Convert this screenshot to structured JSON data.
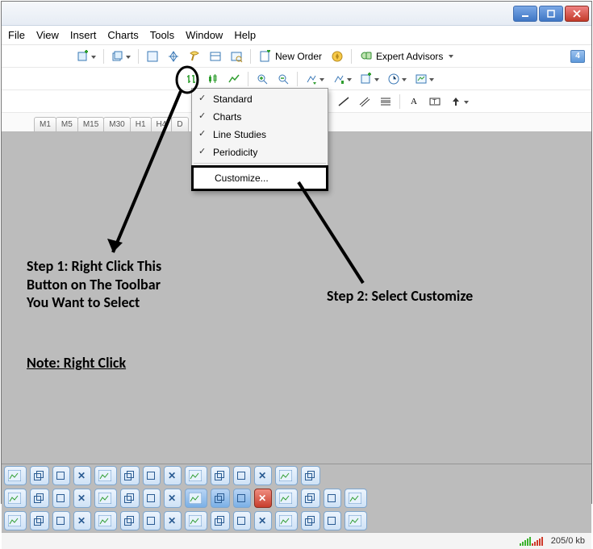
{
  "menu": {
    "file": "File",
    "view": "View",
    "insert": "Insert",
    "charts": "Charts",
    "tools": "Tools",
    "window": "Window",
    "help": "Help"
  },
  "toolbar1": {
    "newOrder": "New Order",
    "expertAdvisors": "Expert Advisors",
    "notificationCount": "4"
  },
  "periods": {
    "m1": "M1",
    "m5": "M5",
    "m15": "M15",
    "m30": "M30",
    "h1": "H1",
    "h4": "H4",
    "d1": "D"
  },
  "contextMenu": {
    "standard": "Standard",
    "charts": "Charts",
    "lineStudies": "Line Studies",
    "periodicity": "Periodicity",
    "customize": "Customize..."
  },
  "annotations": {
    "step1_l1": "Step 1: Right Click This",
    "step1_l2": "Button on The Toolbar",
    "step1_l3": "You Want to Select",
    "step2": "Step 2: Select Customize",
    "note": "Note: Right Click"
  },
  "status": {
    "traffic": "205/0 kb"
  }
}
